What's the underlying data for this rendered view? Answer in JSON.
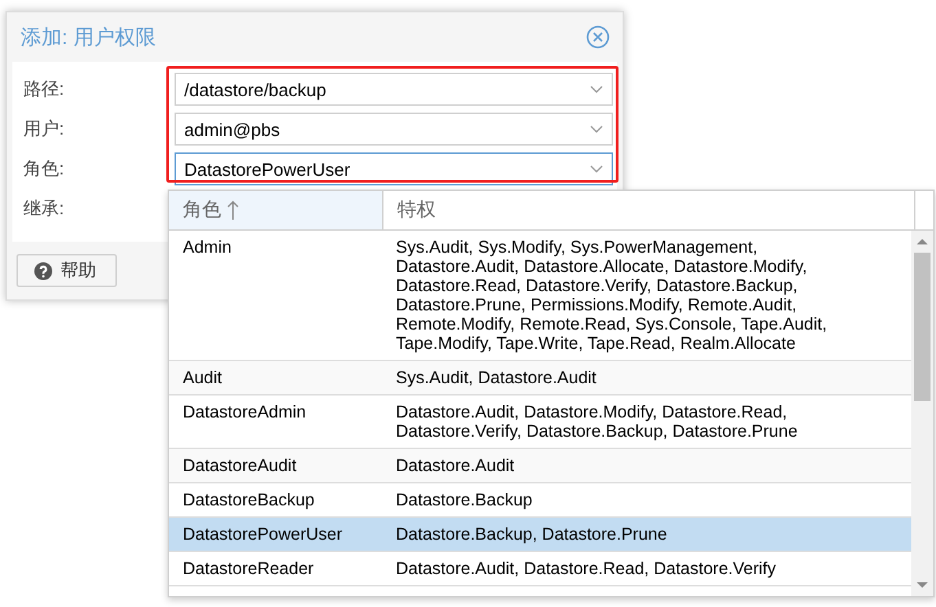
{
  "dialog": {
    "title": "添加: 用户权限",
    "fields": [
      {
        "label": "路径:",
        "value": "/datastore/backup",
        "focused": false
      },
      {
        "label": "用户:",
        "value": "admin@pbs",
        "focused": false
      },
      {
        "label": "角色:",
        "value": "DatastorePowerUser",
        "focused": true
      }
    ],
    "inherit_label": "继承:",
    "help_button": "帮助"
  },
  "role_list": {
    "columns": [
      {
        "label": "角色",
        "sorted": true
      },
      {
        "label": "特权",
        "sorted": false
      }
    ],
    "rows": [
      {
        "role": "Admin",
        "privileges": "Sys.Audit, Sys.Modify, Sys.PowerManagement, Datastore.Audit, Datastore.Allocate, Datastore.Modify, Datastore.Read, Datastore.Verify, Datastore.Backup, Datastore.Prune, Permissions.Modify, Remote.Audit, Remote.Modify, Remote.Read, Sys.Console, Tape.Audit, Tape.Modify, Tape.Write, Tape.Read, Realm.Allocate",
        "selected": false
      },
      {
        "role": "Audit",
        "privileges": "Sys.Audit, Datastore.Audit",
        "selected": false
      },
      {
        "role": "DatastoreAdmin",
        "privileges": "Datastore.Audit, Datastore.Modify, Datastore.Read, Datastore.Verify, Datastore.Backup, Datastore.Prune",
        "selected": false
      },
      {
        "role": "DatastoreAudit",
        "privileges": "Datastore.Audit",
        "selected": false
      },
      {
        "role": "DatastoreBackup",
        "privileges": "Datastore.Backup",
        "selected": false
      },
      {
        "role": "DatastorePowerUser",
        "privileges": "Datastore.Backup, Datastore.Prune",
        "selected": true
      },
      {
        "role": "DatastoreReader",
        "privileges": "Datastore.Audit, Datastore.Read, Datastore.Verify",
        "selected": false
      }
    ]
  }
}
